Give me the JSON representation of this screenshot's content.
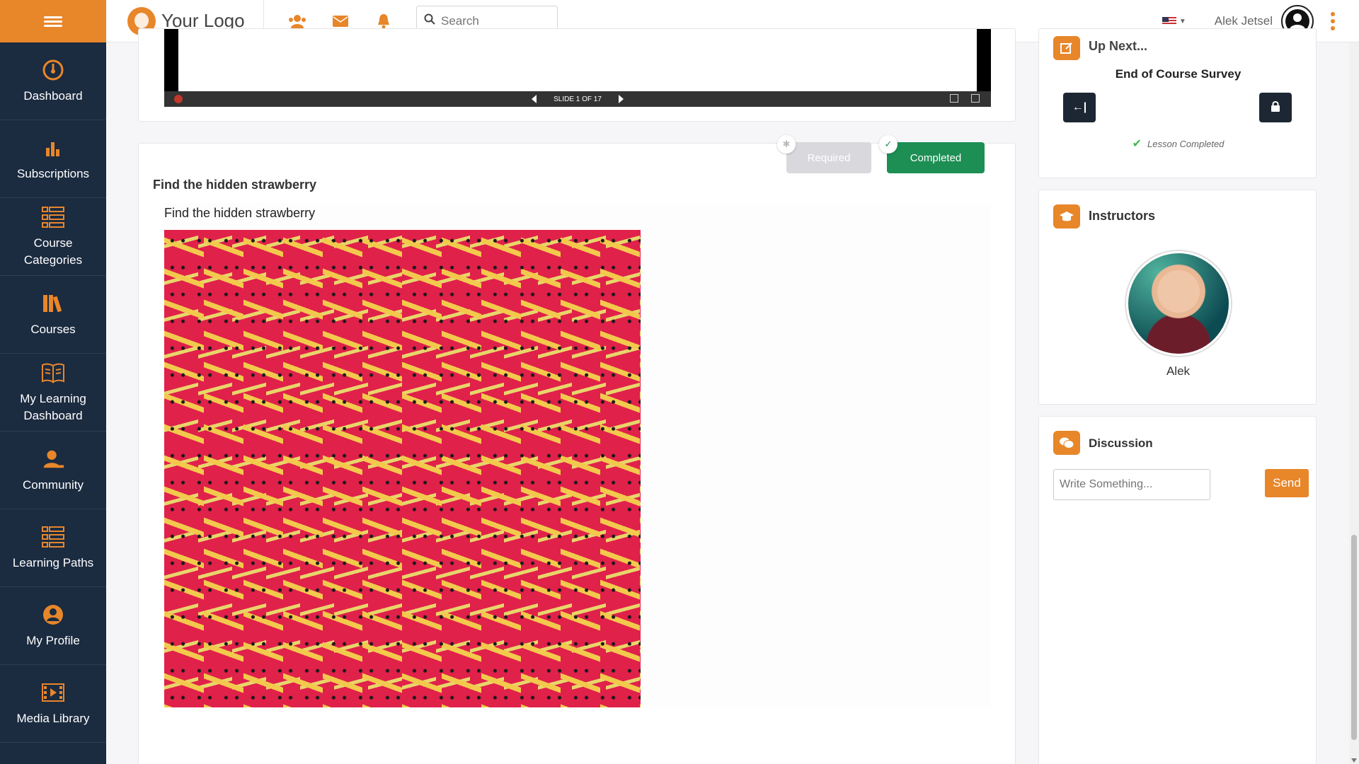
{
  "sidebar": {
    "items": [
      {
        "label": "Dashboard",
        "icon": "dashboard-icon"
      },
      {
        "label": "Subscriptions",
        "icon": "bar-chart-icon"
      },
      {
        "label": "Course Categories",
        "icon": "list-icon"
      },
      {
        "label": "Courses",
        "icon": "books-icon"
      },
      {
        "label": "My Learning Dashboard",
        "icon": "open-book-icon"
      },
      {
        "label": "Community",
        "icon": "users-icon"
      },
      {
        "label": "Learning Paths",
        "icon": "list-icon"
      },
      {
        "label": "My Profile",
        "icon": "user-circle-icon"
      },
      {
        "label": "Media Library",
        "icon": "film-icon"
      }
    ]
  },
  "header": {
    "logo_text": "Your Logo",
    "search_placeholder": "Search",
    "user_name": "Alek Jetsel"
  },
  "video": {
    "slide_label": "SLIDE 1 OF 17"
  },
  "lesson": {
    "required_label": "Required",
    "completed_label": "Completed",
    "title": "Find the hidden strawberry",
    "subtitle": "Find the hidden strawberry"
  },
  "up_next": {
    "title": "Up Next...",
    "next_item": "End of Course Survey",
    "status": "Lesson Completed"
  },
  "instructors": {
    "title": "Instructors",
    "name": "Alek"
  },
  "discussion": {
    "title": "Discussion",
    "placeholder": "Write Something...",
    "send_label": "Send"
  },
  "colors": {
    "accent": "#e8862a",
    "sidebar": "#1b2b40",
    "completed": "#1d8f54"
  }
}
